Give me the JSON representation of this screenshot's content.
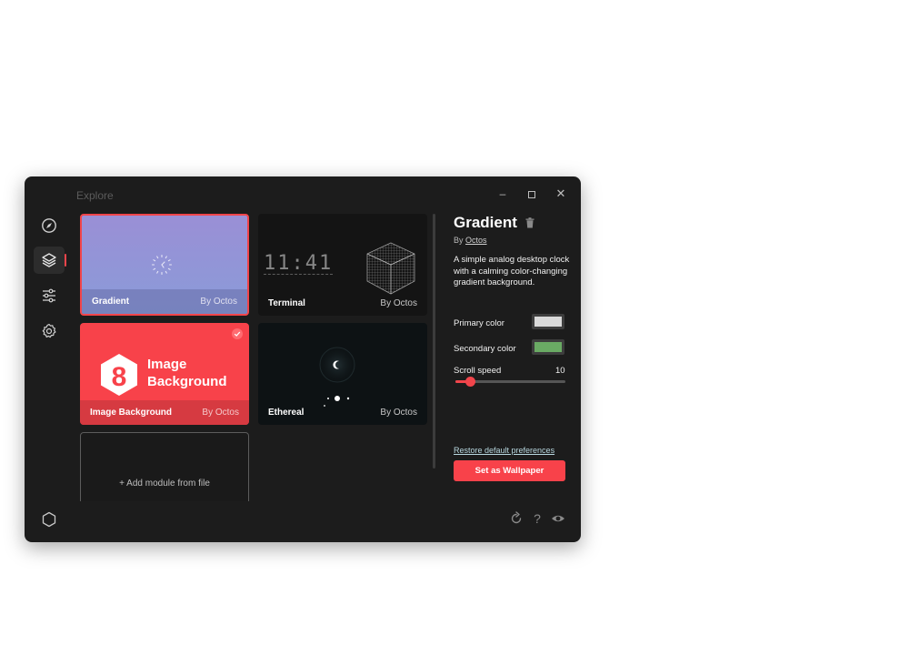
{
  "window": {
    "title": "Explore"
  },
  "window_controls": {
    "minimize": "–",
    "close": "✕"
  },
  "sidebar": {
    "items": [
      {
        "icon": "compass-icon",
        "active": false
      },
      {
        "icon": "layers-icon",
        "active": true
      },
      {
        "icon": "sliders-icon",
        "active": false
      },
      {
        "icon": "gear-icon",
        "active": false
      }
    ],
    "footer_icon": "hexagon-icon"
  },
  "modules": [
    {
      "name": "Gradient",
      "author": "By Octos",
      "selected": true
    },
    {
      "name": "Terminal",
      "author": "By Octos",
      "preview_time": "11:41"
    },
    {
      "name": "Image Background",
      "author": "By Octos",
      "preview_text": [
        "Image",
        "Background"
      ],
      "logo_glyph": "8",
      "installed": true
    },
    {
      "name": "Ethereal",
      "author": "By Octos"
    }
  ],
  "add_module": {
    "label": "+ Add module from file"
  },
  "detail": {
    "title": "Gradient",
    "by_prefix": "By",
    "author": "Octos",
    "description": "A simple analog desktop clock with a calming color-changing gradient background.",
    "preferences": {
      "primary_color": {
        "label": "Primary color",
        "value": "#d9d9d9"
      },
      "secondary_color": {
        "label": "Secondary color",
        "value": "#6aaa64"
      },
      "scroll_speed": {
        "label": "Scroll speed",
        "value": "10",
        "fraction": 0.14
      }
    },
    "restore_label": "Restore default preferences",
    "set_wallpaper_label": "Set as Wallpaper"
  },
  "bottom_bar": {
    "icons": [
      "refresh-icon",
      "help-icon",
      "eye-icon"
    ],
    "help_glyph": "?"
  },
  "colors": {
    "accent": "#f8424a",
    "background": "#1c1c1c",
    "selection_border": "#f1454b"
  }
}
